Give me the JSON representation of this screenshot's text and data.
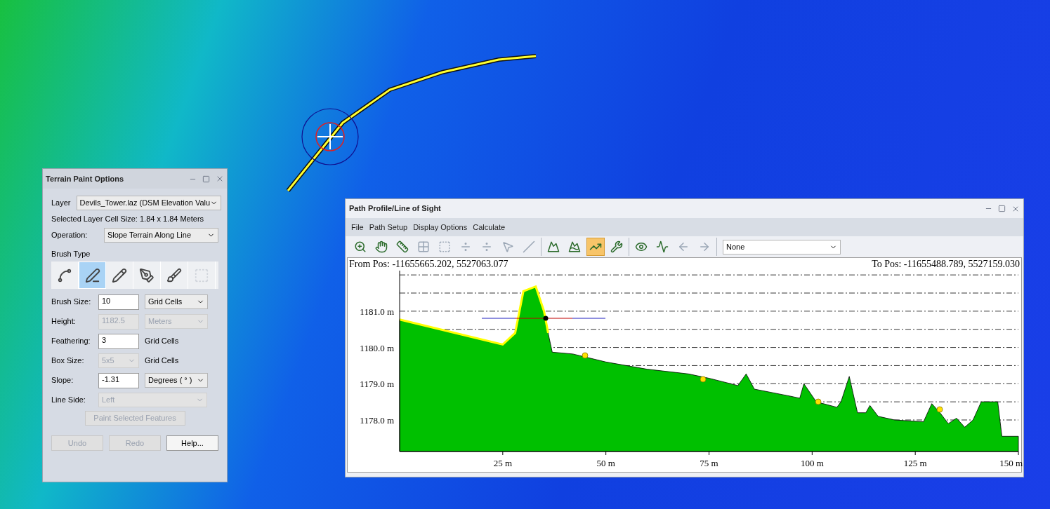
{
  "terrain_paint_options": {
    "title": "Terrain Paint Options",
    "layer": {
      "label": "Layer",
      "value": "Devils_Tower.laz (DSM Elevation Valu"
    },
    "cell_size": "Selected Layer Cell Size: 1.84 x 1.84 Meters",
    "operation": {
      "label": "Operation:",
      "value": "Slope Terrain Along Line"
    },
    "brush_type_label": "Brush Type",
    "brush_types": [
      {
        "kind": "points",
        "selected": false,
        "disabled": false
      },
      {
        "kind": "line",
        "selected": true,
        "disabled": false
      },
      {
        "kind": "freehand",
        "selected": false,
        "disabled": false
      },
      {
        "kind": "area",
        "selected": false,
        "disabled": false
      },
      {
        "kind": "shape",
        "selected": false,
        "disabled": false
      },
      {
        "kind": "box",
        "selected": false,
        "disabled": true
      }
    ],
    "fields": [
      {
        "kind": "input_select",
        "label": "Brush Size:",
        "value": "10",
        "unit": "Grid Cells",
        "disabled": false
      },
      {
        "kind": "input_select",
        "label": "Height:",
        "value": "1182.5",
        "unit": "Meters",
        "disabled": true
      },
      {
        "kind": "input_text",
        "label": "Feathering:",
        "value": "3",
        "unit": "Grid Cells",
        "disabled": false
      },
      {
        "kind": "select_text",
        "label": "Box Size:",
        "value": "5x5",
        "unit": "Grid Cells",
        "disabled": true
      },
      {
        "kind": "input_select",
        "label": "Slope:",
        "value": "-1.31",
        "unit": "Degrees ( ° )",
        "disabled": false
      },
      {
        "kind": "select",
        "label": "Line Side:",
        "value": "Left",
        "disabled": true
      }
    ],
    "paint_button": {
      "label": "Paint Selected Features",
      "disabled": true
    },
    "buttons": [
      {
        "label": "Undo",
        "disabled": true
      },
      {
        "label": "Redo",
        "disabled": true
      },
      {
        "label": "Help...",
        "disabled": false
      }
    ]
  },
  "path_profile": {
    "title": "Path Profile/Line of Sight",
    "menu": [
      "File",
      "Path Setup",
      "Display Options",
      "Calculate"
    ],
    "toolbar_groups": [
      {
        "tools": [
          {
            "kind": "zoom",
            "selected": false,
            "disabled": false
          },
          {
            "kind": "pan",
            "selected": false,
            "disabled": false
          },
          {
            "kind": "measure",
            "selected": false,
            "disabled": false
          },
          {
            "kind": "select_points",
            "selected": false,
            "disabled": true
          },
          {
            "kind": "select_area",
            "selected": false,
            "disabled": true
          },
          {
            "kind": "split",
            "selected": false,
            "disabled": true
          },
          {
            "kind": "merge",
            "selected": false,
            "disabled": true
          },
          {
            "kind": "pointer",
            "selected": false,
            "disabled": true
          },
          {
            "kind": "line",
            "selected": false,
            "disabled": true
          }
        ]
      },
      {
        "tools": [
          {
            "kind": "profile",
            "selected": false,
            "disabled": false
          },
          {
            "kind": "peak",
            "selected": false,
            "disabled": false
          },
          {
            "kind": "slope",
            "selected": true,
            "disabled": false
          },
          {
            "kind": "settings",
            "selected": false,
            "disabled": false
          }
        ]
      },
      {
        "tools": [
          {
            "kind": "view",
            "selected": false,
            "disabled": false
          },
          {
            "kind": "graph",
            "selected": false,
            "disabled": false
          },
          {
            "kind": "back",
            "selected": false,
            "disabled": true
          },
          {
            "kind": "forward",
            "selected": false,
            "disabled": true
          }
        ]
      }
    ],
    "dropdown": {
      "value": "None"
    },
    "from_pos": "From Pos: -11655665.202, 5527063.077",
    "to_pos": "To Pos: -11655488.789, 5527159.030",
    "chart_data": {
      "type": "area",
      "grid": true,
      "xlim": [
        0,
        150
      ],
      "ylim": [
        1177.13,
        1182.08
      ],
      "x": [
        0,
        25,
        28,
        30,
        33,
        35,
        36,
        37,
        42,
        50,
        60,
        70,
        75,
        82,
        84,
        86,
        95,
        97,
        98,
        101,
        106,
        107,
        109,
        111,
        113,
        114,
        116,
        120,
        127,
        129,
        131,
        133,
        135,
        137,
        139,
        141,
        145,
        146,
        150
      ],
      "values": [
        1180.77,
        1180.08,
        1180.4,
        1181.55,
        1181.68,
        1181.0,
        1180.4,
        1179.87,
        1179.82,
        1179.6,
        1179.4,
        1179.27,
        1179.15,
        1178.95,
        1179.27,
        1178.85,
        1178.65,
        1178.6,
        1179.0,
        1178.5,
        1178.35,
        1178.5,
        1179.2,
        1178.2,
        1178.2,
        1178.4,
        1178.1,
        1178.0,
        1177.95,
        1178.45,
        1178.2,
        1177.9,
        1178.05,
        1177.8,
        1178.0,
        1178.5,
        1178.5,
        1177.55,
        1177.55
      ],
      "xticks": [
        {
          "value": 25,
          "label": "25 m"
        },
        {
          "value": 50,
          "label": "50 m"
        },
        {
          "value": 75,
          "label": "75 m"
        },
        {
          "value": 100,
          "label": "100 m"
        },
        {
          "value": 125,
          "label": "125 m"
        },
        {
          "value": 150,
          "label": "150 m"
        }
      ],
      "yticks": [
        {
          "value": 1178,
          "label": "1178.0 m"
        },
        {
          "value": 1179,
          "label": "1179.0 m"
        },
        {
          "value": 1180,
          "label": "1180.0 m"
        },
        {
          "value": 1181,
          "label": "1181.0 m"
        }
      ]
    }
  }
}
